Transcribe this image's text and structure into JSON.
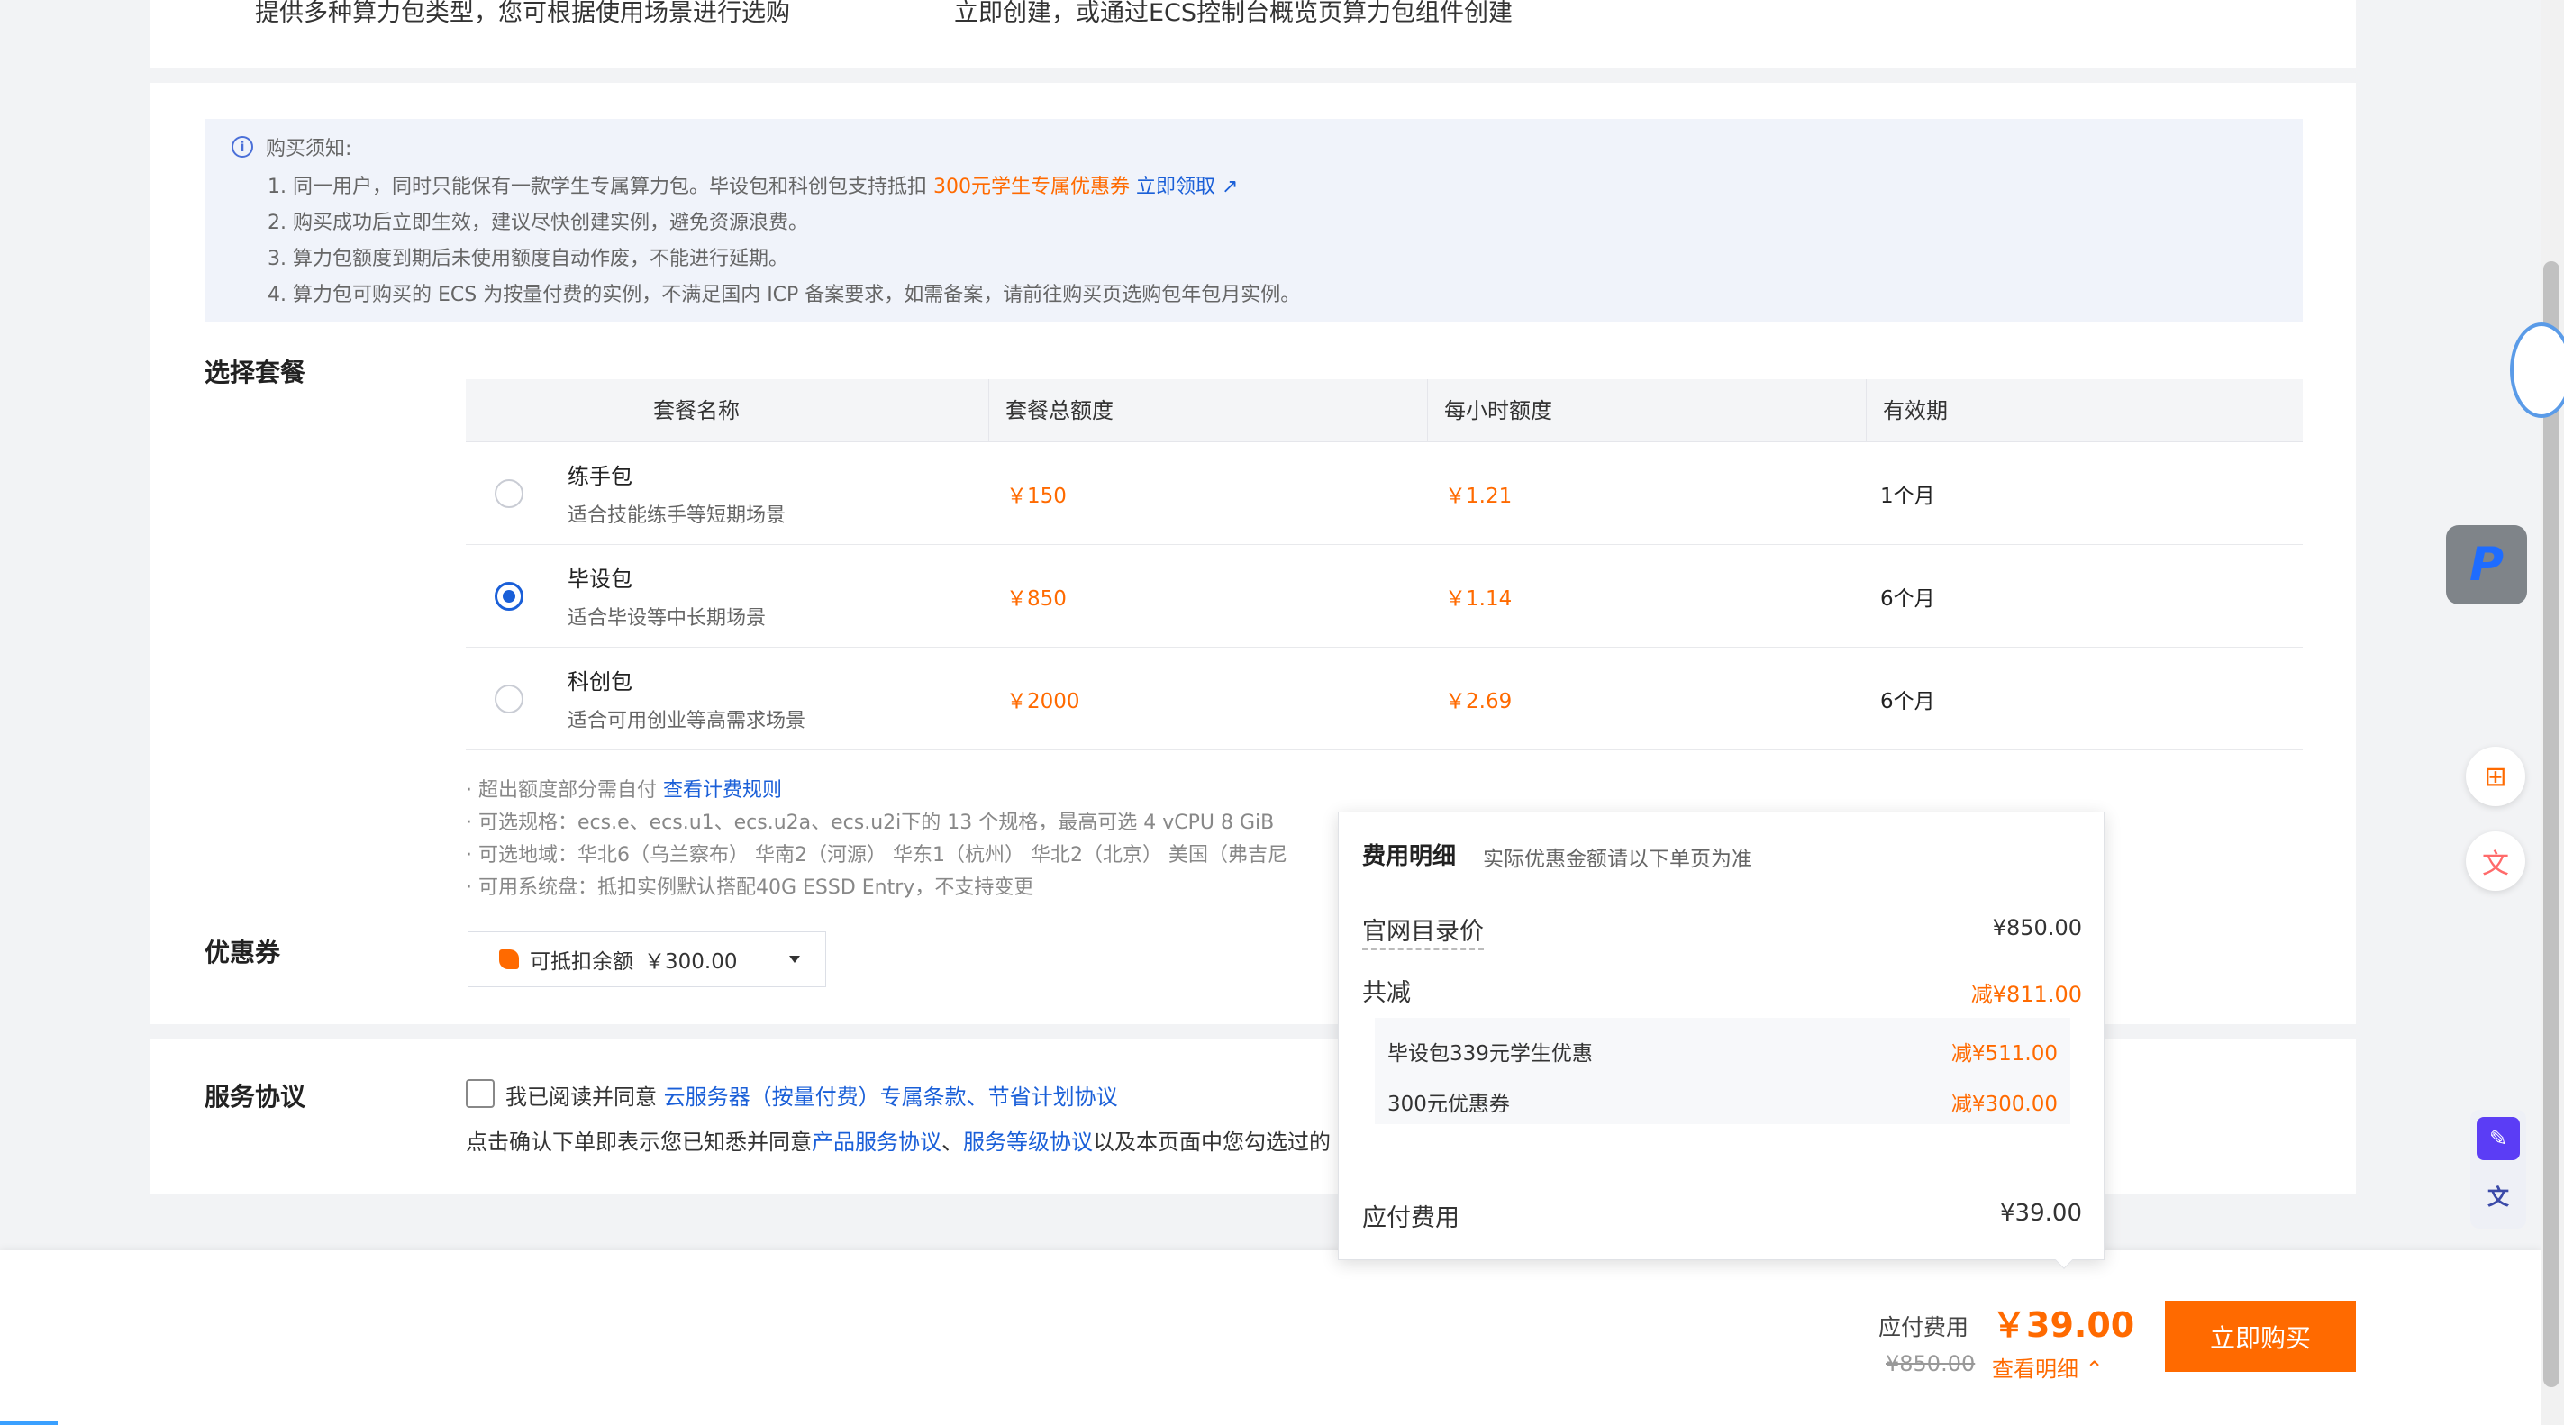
{
  "top": {
    "left_text": "提供多种算力包类型，您可根据使用场景进行选购",
    "right_text": "立即创建，或通过ECS控制台概览页算力包组件创建"
  },
  "notice": {
    "title": "购买须知:",
    "line1_prefix": "1. 同一用户，同时只能保有一款学生专属算力包。毕设包和科创包支持抵扣",
    "line1_highlight": "300元学生专属优惠券",
    "line1_link": "立即领取",
    "line2": "2. 购买成功后立即生效，建议尽快创建实例，避免资源浪费。",
    "line3": "3. 算力包额度到期后未使用额度自动作废，不能进行延期。",
    "line4": "4. 算力包可购买的 ECS 为按量付费的实例，不满足国内 ICP 备案要求，如需备案，请前往购买页选购包年包月实例。"
  },
  "plan": {
    "section_title": "选择套餐",
    "headers": [
      "套餐名称",
      "套餐总额度",
      "每小时额度",
      "有效期"
    ],
    "rows": [
      {
        "name": "练手包",
        "desc": "适合技能练手等短期场景",
        "total": "￥150",
        "hourly": "￥1.21",
        "period": "1个月",
        "selected": false
      },
      {
        "name": "毕设包",
        "desc": "适合毕设等中长期场景",
        "total": "￥850",
        "hourly": "￥1.14",
        "period": "6个月",
        "selected": true
      },
      {
        "name": "科创包",
        "desc": "适合可用创业等高需求场景",
        "total": "￥2000",
        "hourly": "￥2.69",
        "period": "6个月",
        "selected": false
      }
    ],
    "note1_prefix": "· 超出额度部分需自付",
    "note1_link": "查看计费规则",
    "note2": "· 可选规格：ecs.e、ecs.u1、ecs.u2a、ecs.u2i下的 13 个规格，最高可选 4 vCPU 8 GiB",
    "note3": "· 可选地域：华北6（乌兰察布） 华南2（河源） 华东1（杭州） 华北2（北京） 美国（弗吉尼",
    "note4": "· 可用系统盘：抵扣实例默认搭配40G ESSD Entry，不支持变更"
  },
  "coupon": {
    "section_title": "优惠券",
    "label": "可抵扣余额",
    "value": "￥300.00"
  },
  "service": {
    "section_title": "服务协议",
    "agree_prefix": "我已阅读并同意",
    "agree_link": "云服务器（按量付费）专属条款、节省计划协议",
    "confirm_prefix": "点击确认下单即表示您已知悉并同意",
    "confirm_link1": "产品服务协议",
    "confirm_sep": "、",
    "confirm_link2": "服务等级协议",
    "confirm_suffix": "以及本页面中您勾选过的"
  },
  "popover": {
    "title": "费用明细",
    "subtitle": "实际优惠金额请以下单页为准",
    "list_price_label": "官网目录价",
    "list_price_value": "¥850.00",
    "discount_label": "共减",
    "discount_value": "减¥811.00",
    "item1_label": "毕设包339元学生优惠",
    "item1_value": "减¥511.00",
    "item2_label": "300元优惠券",
    "item2_value": "减¥300.00",
    "payable_label": "应付费用",
    "payable_value": "¥39.00"
  },
  "bottom": {
    "pay_label": "应付费用",
    "pay_value": "￥39.00",
    "original": "¥850.00",
    "detail_link": "查看明细",
    "buy_button": "立即购买"
  },
  "colors": {
    "accent": "#ff6a00",
    "link": "#1a5fd8",
    "notice_bg": "#f0f3fa"
  }
}
